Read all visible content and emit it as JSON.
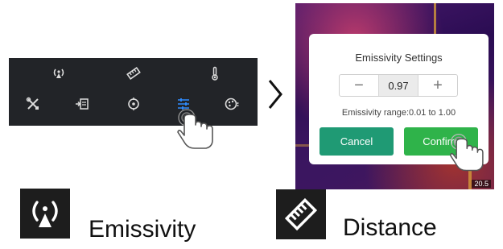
{
  "toolbar": {
    "tools": [
      {
        "name": "emissivity",
        "icon": "emissivity-icon"
      },
      {
        "name": "distance",
        "icon": "distance-icon"
      },
      {
        "name": "thermometer",
        "icon": "thermometer-icon"
      },
      {
        "name": "tools",
        "icon": "tools-icon"
      },
      {
        "name": "export",
        "icon": "export-icon"
      },
      {
        "name": "target",
        "icon": "target-icon"
      },
      {
        "name": "settings-sliders",
        "icon": "sliders-icon"
      },
      {
        "name": "palette",
        "icon": "palette-icon"
      }
    ],
    "active_color": "#2f8cff"
  },
  "dialog": {
    "title": "Emissivity Settings",
    "decrement_label": "−",
    "value": "0.97",
    "increment_label": "+",
    "range_text": "Emissivity range:0.01 to 1.00",
    "cancel_label": "Cancel",
    "confirm_label": "Confirm"
  },
  "thermal": {
    "temp_readout": "20.5"
  },
  "legend": {
    "emissivity_label": "Emissivity",
    "distance_label": "Distance"
  },
  "colors": {
    "cancel": "#1f9a74",
    "confirm": "#2fb34a",
    "toolbar_bg": "#222428"
  }
}
